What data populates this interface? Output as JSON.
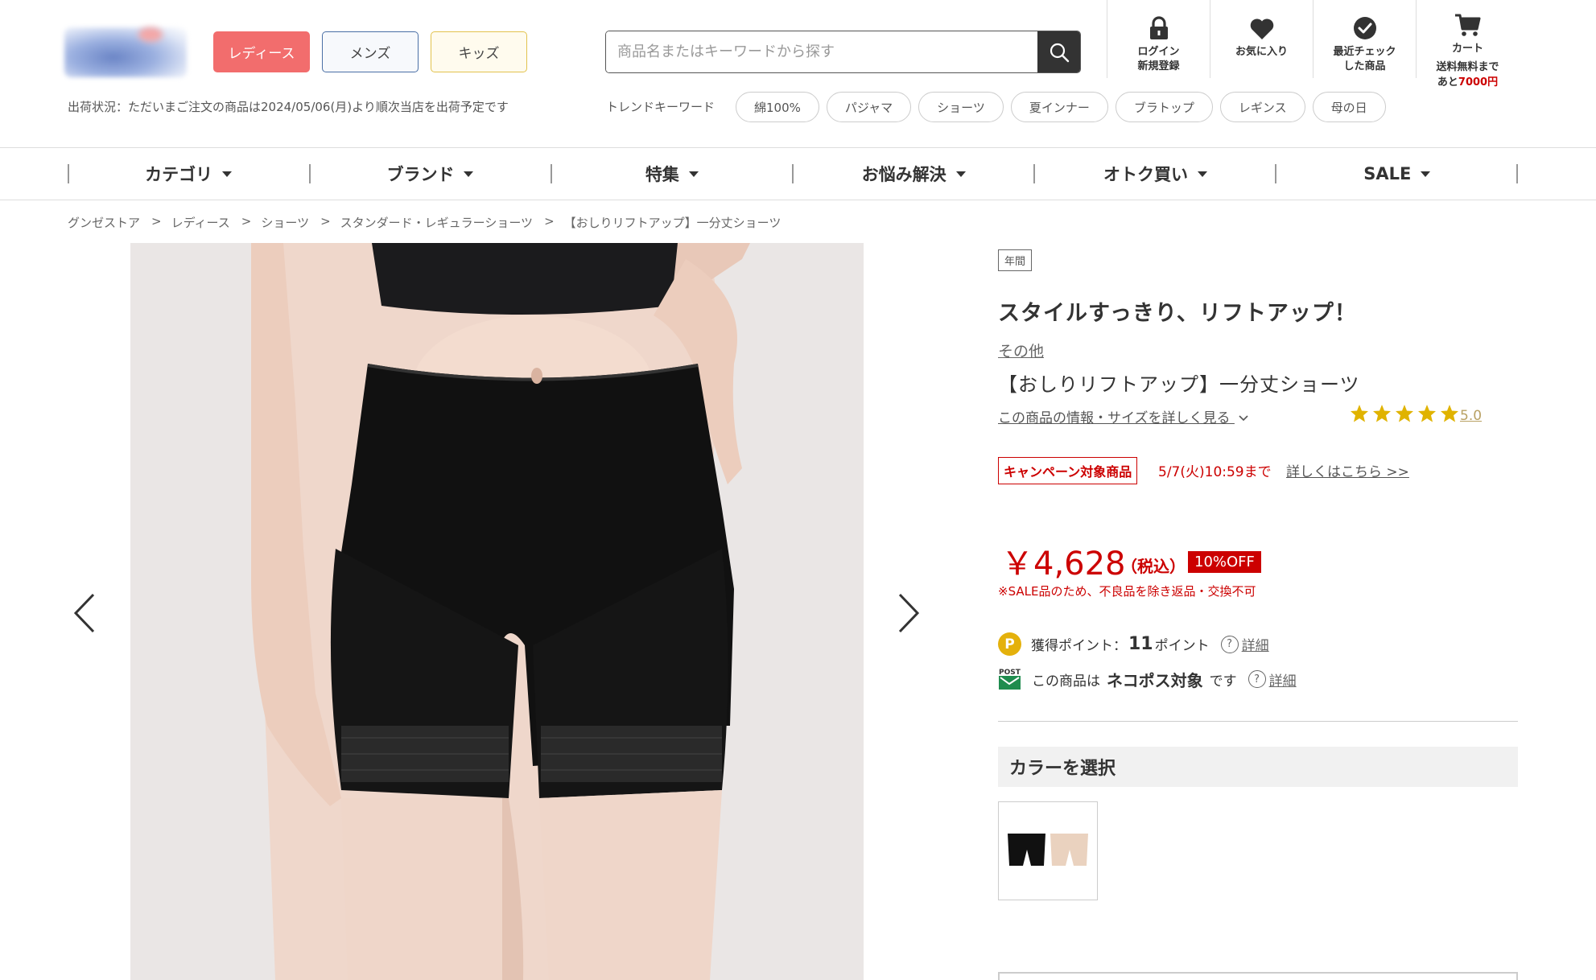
{
  "header": {
    "gender_tabs": [
      "レディース",
      "メンズ",
      "キッズ"
    ],
    "ship_status": "出荷状況：ただいまご注文の商品は2024/05/06(月)より順次当店を出荷予定です",
    "search_placeholder": "商品名またはキーワードから探す",
    "trend_label": "トレンドキーワード",
    "trend_tags": [
      "綿100%",
      "パジャマ",
      "ショーツ",
      "夏インナー",
      "ブラトップ",
      "レギンス",
      "母の日"
    ],
    "icons": {
      "login": "ログイン\n新規登録",
      "favorites": "お気に入り",
      "recent": "最近チェック\nした商品",
      "cart": "カート",
      "cart_note_1": "送料無料まで",
      "cart_note_2a": "あと",
      "cart_note_2b": "7000円"
    }
  },
  "nav": [
    "カテゴリ",
    "ブランド",
    "特集",
    "お悩み解決",
    "オトク買い",
    "SALE"
  ],
  "breadcrumb": [
    "グンゼストア",
    "レディース",
    "ショーツ",
    "スタンダード・レギュラーショーツ",
    "【おしりリフトアップ】一分丈ショーツ"
  ],
  "product": {
    "season_badge": "年間",
    "catchcopy": "スタイルすっきり、リフトアップ！",
    "brand": "その他",
    "name": "【おしりリフトアップ】一分丈ショーツ",
    "info_link": "この商品の情報・サイズを詳しく見る",
    "rating": "5.0",
    "rating_value": 5,
    "campaign_badge": "キャンペーン対象商品",
    "campaign_until": "5/7(火)10:59まで",
    "campaign_link": "詳しくはこちら >>",
    "price": "￥4,628",
    "tax": "（税込）",
    "off_badge": "10%OFF",
    "sale_note": "※SALE品のため、不良品を除き返品・交換不可",
    "points_label": "獲得ポイント：",
    "points_value": "11",
    "points_unit": "ポイント",
    "detail_link": "詳細",
    "post_prefix": "この商品は",
    "post_strong": "ネコポス対象",
    "post_suffix": "です",
    "post_icon_text": "POST",
    "color_heading": "カラーを選択"
  },
  "colors": {
    "accent_red": "#cc0000",
    "ladies": "#f26d6d",
    "star_gold": "#e0b300"
  }
}
